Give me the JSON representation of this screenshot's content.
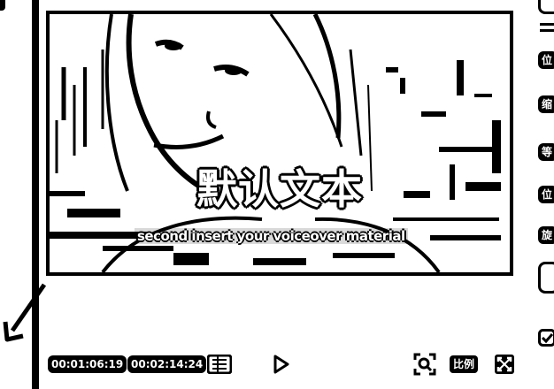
{
  "preview": {
    "title_text": "默认文本",
    "subtitle_text": "second insert your voiceover material"
  },
  "controls": {
    "current_time": "00:01:06:19",
    "total_time": "00:02:14:24",
    "ratio_label": "比例",
    "icons": [
      "list-icon",
      "play-icon",
      "zoom-focus-icon",
      "fullscreen-icon"
    ]
  },
  "right_panel": {
    "labels": [
      "位",
      "缩",
      "等",
      "位",
      "旋"
    ]
  },
  "colors": {
    "foreground": "#000000",
    "background": "#ffffff"
  }
}
